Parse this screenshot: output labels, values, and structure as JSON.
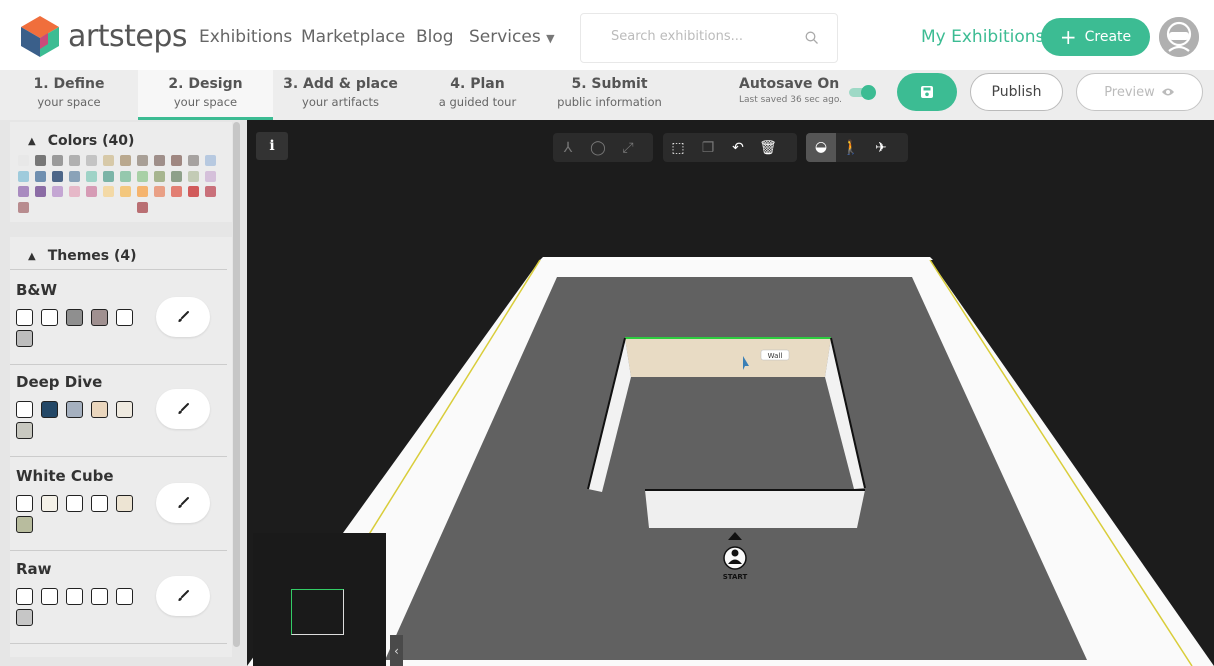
{
  "header": {
    "brand": "artsteps",
    "nav": [
      "Exhibitions",
      "Marketplace",
      "Blog",
      "Services"
    ],
    "search_placeholder": "Search exhibitions...",
    "my_exhibitions": "My Exhibitions",
    "create_label": "Create"
  },
  "steps": [
    {
      "title": "1. Define",
      "subtitle": "your space",
      "active": false
    },
    {
      "title": "2. Design",
      "subtitle": "your space",
      "active": true
    },
    {
      "title": "3. Add & place",
      "subtitle": "your artifacts",
      "active": false
    },
    {
      "title": "4. Plan",
      "subtitle": "a guided tour",
      "active": false
    },
    {
      "title": "5. Submit",
      "subtitle": "public information",
      "active": false
    }
  ],
  "autosave": {
    "title": "Autosave On",
    "subtitle": "Last saved 36 sec ago.",
    "enabled": true
  },
  "actions": {
    "publish": "Publish",
    "preview": "Preview"
  },
  "colors_panel": {
    "title": "Colors (40)",
    "swatches": [
      "#e8e8e8",
      "#777777",
      "#9a9a9a",
      "#b0b0b0",
      "#c4c4c4",
      "#d7c9a8",
      "#b9a88e",
      "#a89f96",
      "#9f8f8a",
      "#9f8781",
      "#a6a2a0",
      "#b7c9e0",
      "#9fcbdc",
      "#6f8fb0",
      "#4d6688",
      "#8aa2b8",
      "#9fd3c7",
      "#7bb4a7",
      "#95c8ad",
      "#a8d0a6",
      "#a7b58f",
      "#8ea08a",
      "#c3cbb5",
      "#d5c0da",
      "#a98bc0",
      "#8b6ca5",
      "#c4a6d3",
      "#e6b8c8",
      "#d69bb5",
      "#f3d9a6",
      "#f3c77e",
      "#f5b46e",
      "#e9a086",
      "#e27e73",
      "#d15b5b",
      "#c9707a",
      "#b88c8f",
      "#b96f73"
    ]
  },
  "themes_panel": {
    "title": "Themes (4)",
    "themes": [
      {
        "name": "B&W",
        "swatches": [
          "#ffffff",
          "#ffffff",
          "#8f8f8f",
          "#a09090",
          "#ffffff",
          "#bdbdbd"
        ]
      },
      {
        "name": "Deep Dive",
        "swatches": [
          "#ffffff",
          "#234766",
          "#a5b0bf",
          "#ead6bd",
          "#efeae0",
          "#c8c8c0"
        ]
      },
      {
        "name": "White Cube",
        "swatches": [
          "#ffffff",
          "#f4f1e8",
          "#ffffff",
          "#ffffff",
          "#ede4d3",
          "#b8bc9e"
        ]
      },
      {
        "name": "Raw",
        "swatches": [
          "#ffffff",
          "#ffffff",
          "#ffffff",
          "#ffffff",
          "#ffffff",
          "#c6c6c6"
        ]
      }
    ]
  },
  "viewport": {
    "info_label": "i",
    "wall_tooltip": "Wall",
    "start_label": "START"
  },
  "colors": {
    "accent": "#3cbc93"
  }
}
